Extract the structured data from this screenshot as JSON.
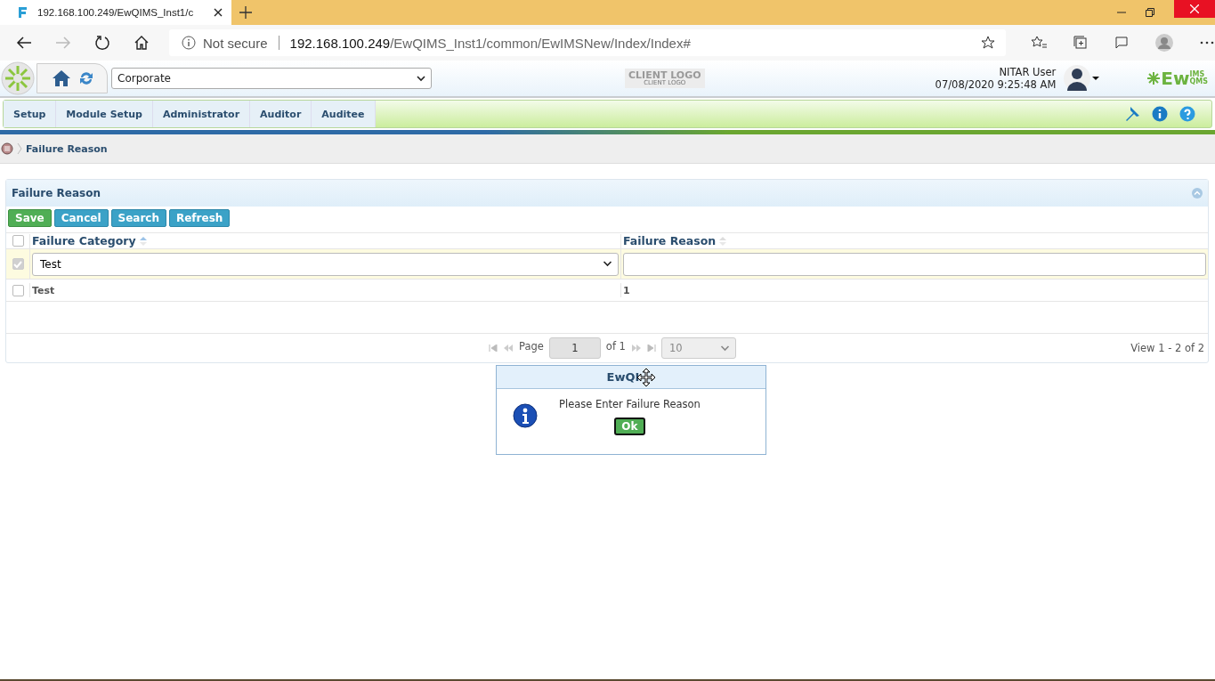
{
  "browser": {
    "tab_title": "192.168.100.249/EwQIMS_Inst1/c",
    "security": "Not secure",
    "url_host": "192.168.100.249",
    "url_path": "/EwQIMS_Inst1/common/EwIMSNew/Index/Index#"
  },
  "header": {
    "location": "Corporate",
    "client_logo": "CLIENT LOGO",
    "client_logo_sub": "CLIENT LOGO",
    "user": "NITAR User",
    "datetime": "07/08/2020 9:25:48 AM",
    "brand": "Ew",
    "brand_sup": "IMS",
    "brand_sub": "QMS"
  },
  "nav": {
    "tabs": [
      {
        "label": "Setup",
        "selected": false
      },
      {
        "label": "Module Setup",
        "selected": false
      },
      {
        "label": "Administrator",
        "selected": false
      },
      {
        "label": "Auditor",
        "selected": false
      },
      {
        "label": "Auditee",
        "selected": false
      }
    ]
  },
  "breadcrumb": "Failure Reason",
  "panel": {
    "title": "Failure Reason",
    "buttons": [
      {
        "label": "Save",
        "kind": "save"
      },
      {
        "label": "Cancel",
        "kind": "default"
      },
      {
        "label": "Search",
        "kind": "default"
      },
      {
        "label": "Refresh",
        "kind": "default"
      }
    ],
    "header_checked": false,
    "columns": [
      "Failure Category",
      "Failure Reason"
    ],
    "edit_row": {
      "checked": true,
      "category": "Test"
    },
    "rows": [
      {
        "checked": false,
        "cells": [
          "Test",
          "1"
        ]
      }
    ],
    "pager": {
      "page_label": "Page",
      "page": "1",
      "of": "of 1",
      "page_size": "10",
      "view": "View 1 - 2 of 2"
    }
  },
  "dialog": {
    "title": "EwQI",
    "message": "Please Enter Failure Reason",
    "ok": "Ok"
  }
}
